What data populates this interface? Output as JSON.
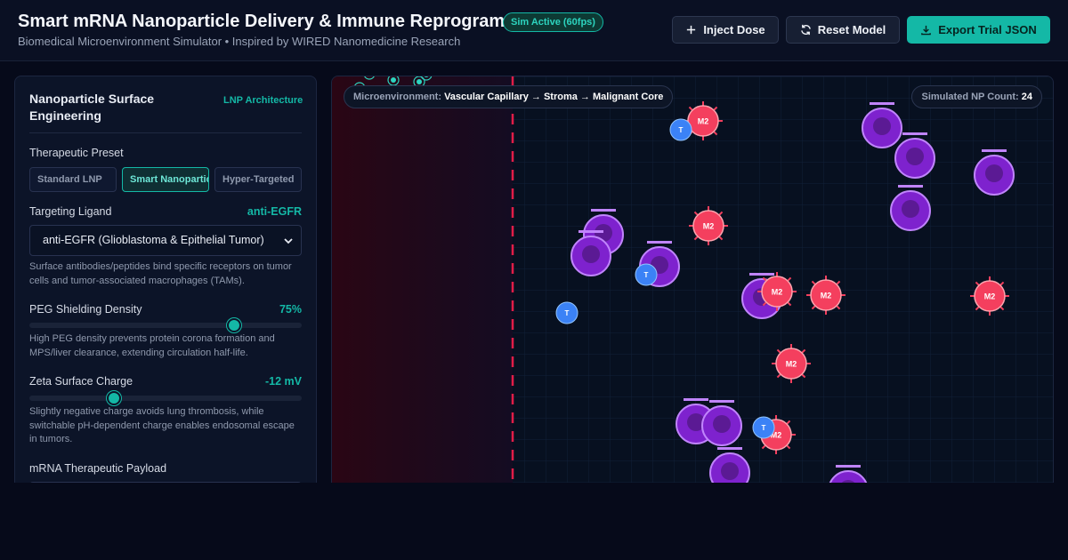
{
  "header": {
    "title": "Smart mRNA Nanoparticle Delivery & Immune Reprogramming",
    "status_badge": "Sim Active (60fps)",
    "subtitle": "Biomedical Microenvironment Simulator • Inspired by WIRED Nanomedicine Research",
    "buttons": {
      "inject": "Inject Dose",
      "reset": "Reset Model",
      "export": "Export Trial JSON"
    }
  },
  "panel": {
    "title": "Nanoparticle Surface Engineering",
    "tag": "LNP Architecture",
    "preset_label": "Therapeutic Preset",
    "presets": [
      "Standard LNP",
      "Smart Nanoparticle",
      "Hyper-Targeted"
    ],
    "selected_preset": "Smart Nanoparticle",
    "ligand_label": "Targeting Ligand",
    "ligand_value": "anti-EGFR",
    "ligand_select": "anti-EGFR (Glioblastoma & Epithelial Tumor)",
    "ligand_desc": "Surface antibodies/peptides bind specific receptors on tumor cells and tumor-associated macrophages (TAMs).",
    "peg_label": "PEG Shielding Density",
    "peg_value": "75%",
    "peg_level": 0.75,
    "peg_desc": "High PEG density prevents protein corona formation and MPS/liver clearance, extending circulation half-life.",
    "zeta_label": "Zeta Surface Charge",
    "zeta_value": "-12 mV",
    "zeta_level": 0.31,
    "zeta_desc": "Slightly negative charge avoids lung thrombosis, while switchable pH-dependent charge enables endosomal escape in tumors.",
    "payload_label": "mRNA Therapeutic Payload"
  },
  "simulation": {
    "env_label": "Microenvironment:",
    "env_path": "Vascular Capillary → Stroma → Malignant Core",
    "np_count_label": "Simulated NP Count:",
    "np_count": "24",
    "m2_label": "M2",
    "t_label": "T",
    "colors": {
      "tumor_cell": "#7e22ce",
      "tumor_ring": "#c084fc",
      "m2_macrophage": "#f43f5e",
      "t_cell": "#3b82f6",
      "vessel_wall": "#e11d48",
      "nanoparticle": "#2dd4bf"
    }
  }
}
